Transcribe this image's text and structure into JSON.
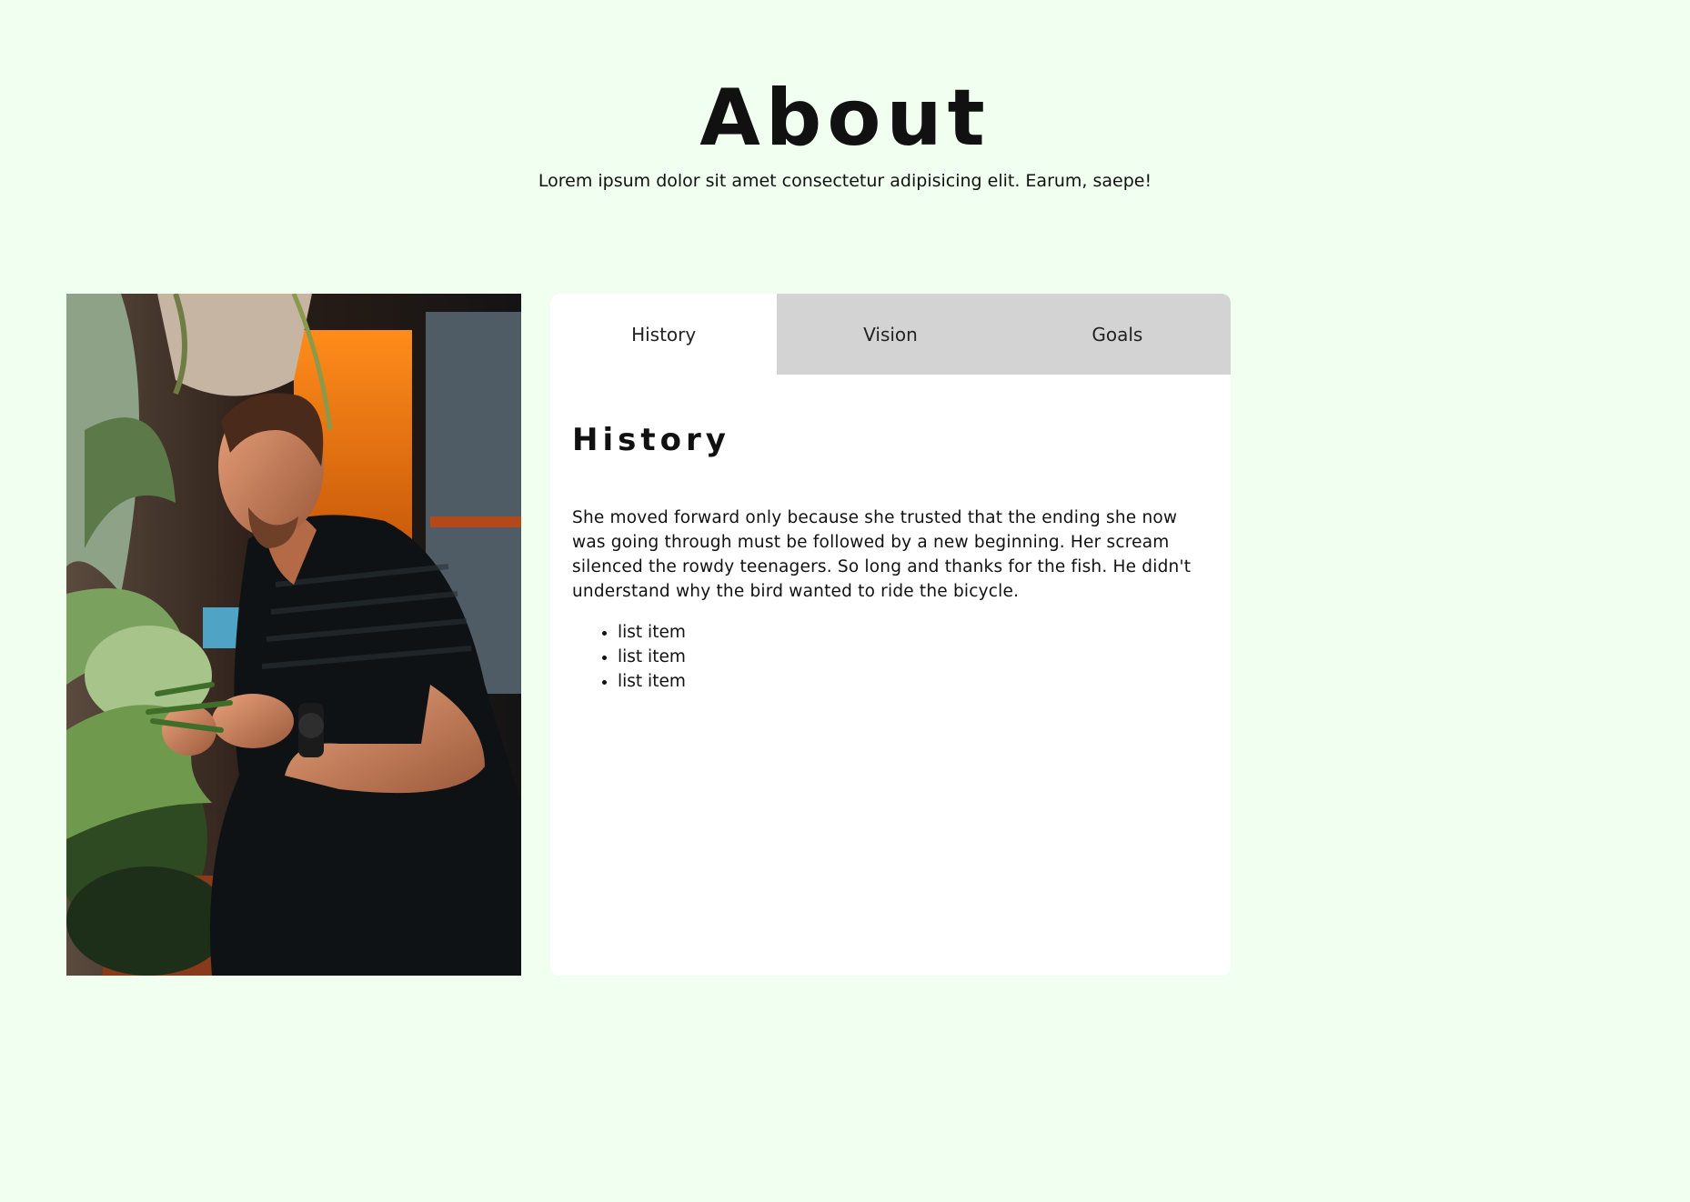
{
  "header": {
    "title": "About",
    "subtitle": "Lorem ipsum dolor sit amet consectetur adipisicing elit. Earum, saepe!"
  },
  "photo": {
    "icon": "person-with-plants-photo"
  },
  "tabs": [
    {
      "label": "History",
      "active": true
    },
    {
      "label": "Vision",
      "active": false
    },
    {
      "label": "Goals",
      "active": false
    }
  ],
  "panel": {
    "title": "History",
    "text": "She moved forward only because she trusted that the ending she now was going through must be followed by a new beginning. Her scream silenced the rowdy teenagers. So long and thanks for the fish. He didn't understand why the bird wanted to ride the bicycle.",
    "list": [
      "list item",
      "list item",
      "list item"
    ]
  },
  "colors": {
    "page_background": "#f0fff0",
    "card_background": "#ffffff",
    "inactive_tab": "#d3d3d3"
  }
}
